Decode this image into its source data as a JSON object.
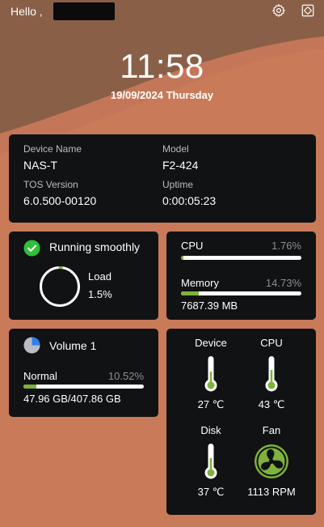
{
  "header": {
    "greeting": "Hello ,",
    "username_redacted": true,
    "icons": [
      "gear-icon",
      "fullscreen-icon"
    ]
  },
  "clock": {
    "time": "11:58",
    "date": "19/09/2024 Thursday"
  },
  "device": {
    "name_label": "Device Name",
    "name_value": "NAS-T",
    "model_label": "Model",
    "model_value": "F2-424",
    "tos_label": "TOS Version",
    "tos_value": "6.0.500-00120",
    "uptime_label": "Uptime",
    "uptime_value": "0:00:05:23"
  },
  "status": {
    "text": "Running smoothly",
    "load_label": "Load",
    "load_value": "1.5%",
    "load_fraction": 0.015
  },
  "resources": {
    "cpu_label": "CPU",
    "cpu_pct": "1.76%",
    "cpu_fraction": 0.0176,
    "mem_label": "Memory",
    "mem_pct": "14.73%",
    "mem_fraction": 0.1473,
    "mem_used": "7687.39 MB"
  },
  "volume": {
    "name": "Volume 1",
    "state": "Normal",
    "pct": "10.52%",
    "fraction": 0.1052,
    "usage": "47.96 GB/407.86 GB"
  },
  "temps": {
    "device_label": "Device",
    "device_value": "27 ℃",
    "cpu_label": "CPU",
    "cpu_value": "43 ℃",
    "disk_label": "Disk",
    "disk_value": "37 ℃",
    "fan_label": "Fan",
    "fan_value": "1113 RPM"
  },
  "colors": {
    "accent_green": "#7fb23a",
    "ok_green": "#2fbf3b",
    "volume_blue": "#2f7ff0",
    "card": "#111214"
  }
}
